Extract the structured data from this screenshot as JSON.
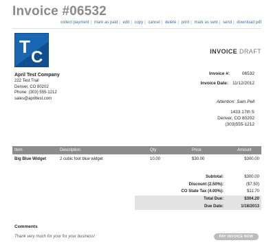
{
  "header": {
    "title": "Invoice #06532",
    "actions": [
      "collect payment",
      "mark as paid",
      "edit",
      "copy",
      "cancel",
      "delete",
      "print",
      "mark as sent",
      "send",
      "download pdf"
    ]
  },
  "logo": {
    "letters": "TC",
    "color": "#1a66b3"
  },
  "document": {
    "label_bold": "INVOICE",
    "label_status": "DRAFT"
  },
  "company": {
    "name": "April Test Company",
    "address1": "222 Test Trail",
    "address2": "Denver, CO 80202",
    "phone": "Phone: (303) 555-1212",
    "email": "sales@apriltest.com"
  },
  "meta": {
    "invoice_no_label": "Invoice #:",
    "invoice_no": "06532",
    "invoice_date_label": "Invoice Date:",
    "invoice_date": "11/12/2012"
  },
  "bill_to": {
    "attention": "Attention: Sam Pell",
    "line1": "1433 17th S",
    "line2": "Denver, CO 80202",
    "line3": "(303)555-1212"
  },
  "table": {
    "headers": [
      "Item",
      "Description",
      "Qty",
      "Price",
      "Amount"
    ],
    "rows": [
      {
        "item": "Big Blue Widget",
        "description": "2 cubic foot blue widget",
        "qty": "10.00",
        "price": "$30.00",
        "amount": "$300.00"
      }
    ]
  },
  "totals": {
    "subtotal_label": "Subtotal:",
    "subtotal": "$300.00",
    "discount_label": "Discount (2.50%):",
    "discount": "($7.50)",
    "tax_label": "CO State Tax (4.00%):",
    "tax": "$11.70",
    "total_due_label": "Total Due:",
    "total_due": "$304.20",
    "due_date_label": "Due Date:",
    "due_date": "1/18/2013"
  },
  "comments": {
    "heading": "Comments",
    "message": "Thank very much for your for your business!"
  },
  "pay_button": "PAY INVOICE NOW"
}
